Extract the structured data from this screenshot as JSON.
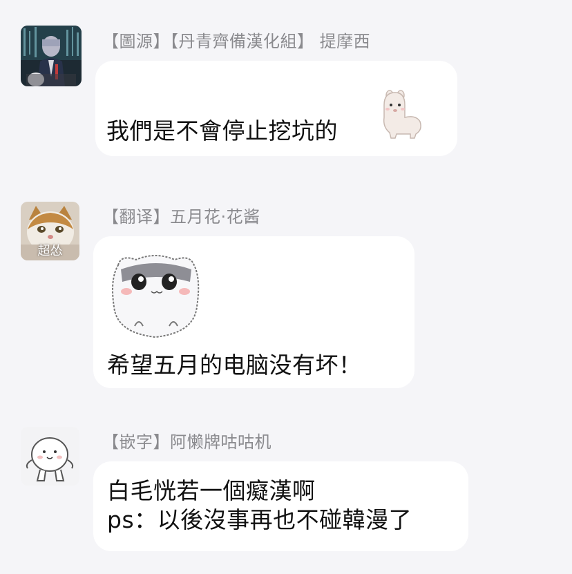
{
  "messages": [
    {
      "sender": "【圖源】【丹青齊備漢化組】 提摩西",
      "lines": [
        "我們是不會停止挖坑的"
      ],
      "sticker": "alpaca-sticker"
    },
    {
      "sender": "【翻译】五月花·花酱",
      "avatar_caption": "超怂",
      "sticker": "hamster-sticker",
      "lines": [
        "希望五月的电脑没有坏！"
      ]
    },
    {
      "sender": "【嵌字】阿懒牌咕咕机",
      "lines": [
        "白毛恍若一個癡漢啊",
        "ps：以後沒事再也不碰韓漫了"
      ]
    }
  ],
  "colors": {
    "background": "#f5f5f8",
    "bubble": "#ffffff",
    "sender_text": "#8a8a8e",
    "message_text": "#111111"
  }
}
